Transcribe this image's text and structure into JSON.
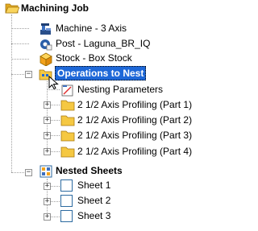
{
  "tree": {
    "root": {
      "label": "Machining Job",
      "icon": "folder-open-icon"
    },
    "machine": {
      "label": "Machine - 3 Axis",
      "icon": "machine-icon"
    },
    "post": {
      "label": "Post - Laguna_BR_IQ",
      "icon": "post-icon"
    },
    "stock": {
      "label": "Stock - Box Stock",
      "icon": "stock-box-icon"
    },
    "operations": {
      "label": "Operations to Nest",
      "expander": "−",
      "children": [
        {
          "label": "Nesting Parameters",
          "icon": "nesting-parameters-icon"
        },
        {
          "label": "2 1/2 Axis Profiling (Part 1)",
          "expander": "+"
        },
        {
          "label": "2 1/2 Axis Profiling (Part 2)",
          "expander": "+"
        },
        {
          "label": "2 1/2 Axis Profiling (Part 3)",
          "expander": "+"
        },
        {
          "label": "2 1/2 Axis Profiling (Part 4)",
          "expander": "+"
        }
      ]
    },
    "nested_sheets": {
      "label": "Nested Sheets",
      "expander": "−",
      "children": [
        {
          "label": "Sheet 1",
          "expander": "+"
        },
        {
          "label": "Sheet 2",
          "expander": "+"
        },
        {
          "label": "Sheet 3",
          "expander": "+"
        }
      ]
    }
  },
  "colors": {
    "selection": "#1e68d8",
    "folder": "#f5c842",
    "tree_line": "#a0a0a0"
  }
}
